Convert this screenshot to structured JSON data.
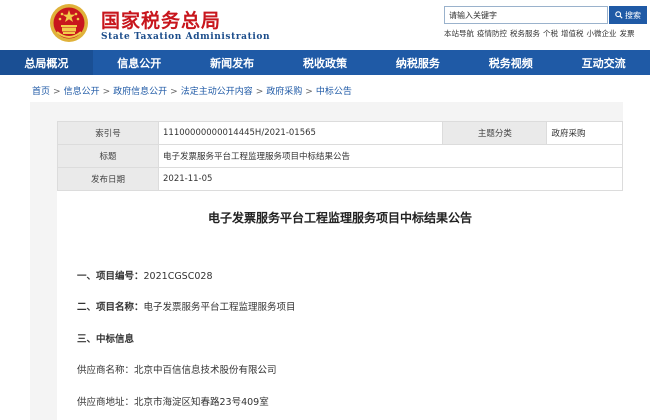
{
  "header": {
    "title": "国家税务总局",
    "subtitle": "State Taxation Administration",
    "search_placeholder": "请输入关键字",
    "search_button": "搜索",
    "quick_links": [
      "本站导航",
      "疫情防控",
      "税务服务",
      "个税",
      "增值税",
      "小微企业",
      "发票"
    ]
  },
  "nav": {
    "items": [
      "总局概况",
      "信息公开",
      "新闻发布",
      "税收政策",
      "纳税服务",
      "税务视频",
      "互动交流"
    ]
  },
  "breadcrumb": [
    "首页",
    "信息公开",
    "政府信息公开",
    "法定主动公开内容",
    "政府采购",
    "中标公告"
  ],
  "meta": {
    "index_label": "索引号",
    "index_value": "11100000000014445H/2021-01565",
    "category_label": "主题分类",
    "category_value": "政府采购",
    "title_label": "标题",
    "title_value": "电子发票服务平台工程监理服务项目中标结果公告",
    "date_label": "发布日期",
    "date_value": "2021-11-05"
  },
  "article": {
    "title": "电子发票服务平台工程监理服务项目中标结果公告",
    "s1_label": "一、项目编号：",
    "s1_value": "2021CGSC028",
    "s2_label": "二、项目名称：",
    "s2_value": "电子发票服务平台工程监理服务项目",
    "s3_label": "三、中标信息",
    "supplier_name": "供应商名称：北京中百信信息技术股份有限公司",
    "supplier_address": "供应商地址：北京市海淀区知春路23号409室"
  },
  "colors": {
    "brand_red": "#c8161d",
    "nav_blue": "#1f5aa6"
  }
}
